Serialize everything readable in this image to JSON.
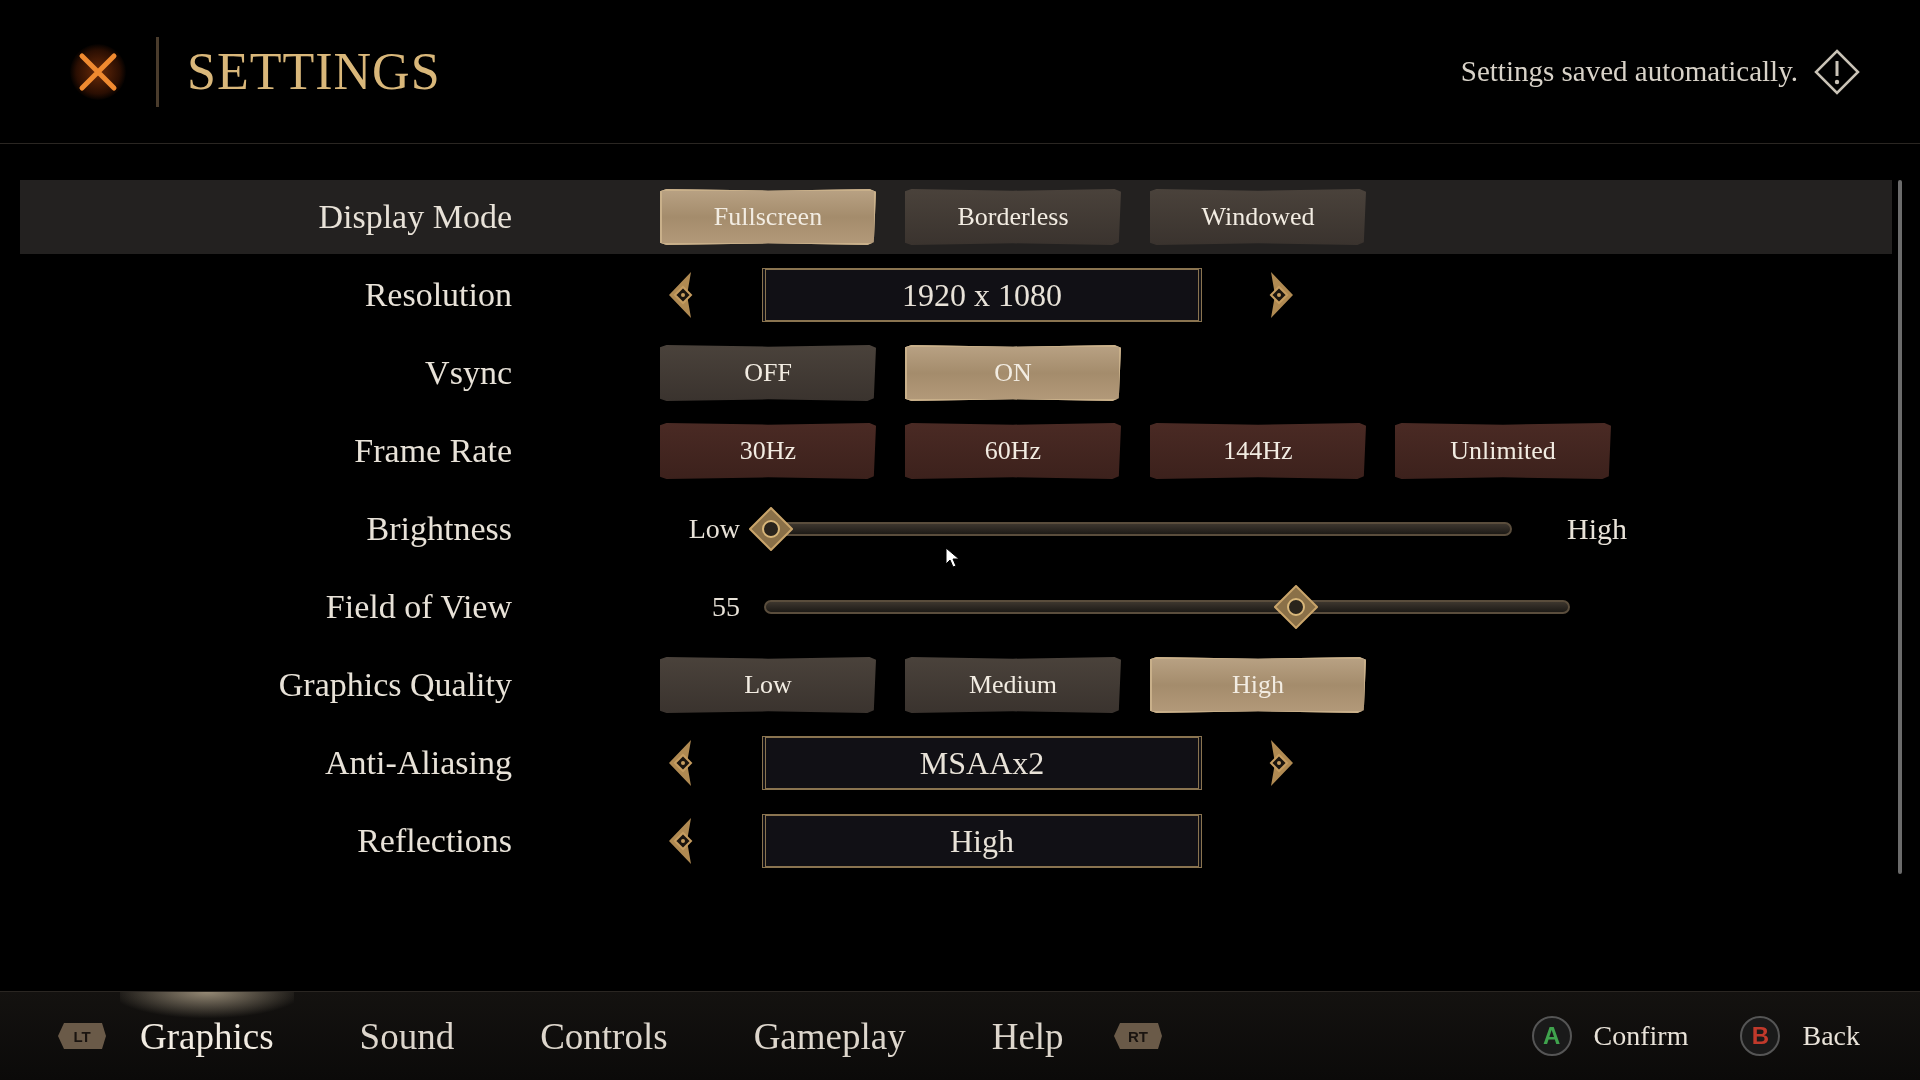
{
  "header": {
    "title": "SETTINGS",
    "status": "Settings saved automatically."
  },
  "rows": [
    {
      "label": "Display Mode",
      "kind": "options",
      "selected": true,
      "options": [
        {
          "label": "Fullscreen",
          "selected": true
        },
        {
          "label": "Borderless",
          "selected": false
        },
        {
          "label": "Windowed",
          "selected": false
        }
      ]
    },
    {
      "label": "Resolution",
      "kind": "stepper",
      "selected": false,
      "value": "1920 x 1080",
      "right_arrow": true
    },
    {
      "label": "Vsync",
      "kind": "options",
      "selected": false,
      "options": [
        {
          "label": "OFF",
          "selected": false
        },
        {
          "label": "ON",
          "selected": true
        }
      ]
    },
    {
      "label": "Frame Rate",
      "kind": "rate_options",
      "selected": false,
      "options": [
        {
          "label": "30Hz",
          "selected": false
        },
        {
          "label": "60Hz",
          "selected": false
        },
        {
          "label": "144Hz",
          "selected": false
        },
        {
          "label": "Unlimited",
          "selected": false
        }
      ]
    },
    {
      "label": "Brightness",
      "kind": "slider",
      "selected": false,
      "min_label": "Low",
      "max_label": "High",
      "level": 0.01
    },
    {
      "label": "Field of View",
      "kind": "slider",
      "selected": false,
      "min_label": "55",
      "level": 0.66
    },
    {
      "label": "Graphics Quality",
      "kind": "options",
      "selected": false,
      "options": [
        {
          "label": "Low",
          "selected": false
        },
        {
          "label": "Medium",
          "selected": false
        },
        {
          "label": "High",
          "selected": true
        }
      ]
    },
    {
      "label": "Anti-Aliasing",
      "kind": "stepper",
      "selected": false,
      "value": "MSAAx2",
      "right_arrow": true
    },
    {
      "label": "Reflections",
      "kind": "stepper",
      "selected": false,
      "value": "High",
      "right_arrow": false
    }
  ],
  "footer": {
    "prev_key": "LT",
    "next_key": "RT",
    "tabs": [
      {
        "label": "Graphics",
        "selected": true
      },
      {
        "label": "Sound",
        "selected": false
      },
      {
        "label": "Controls",
        "selected": false
      },
      {
        "label": "Gameplay",
        "selected": false
      },
      {
        "label": "Help",
        "selected": false
      }
    ],
    "actions": [
      {
        "key": "A",
        "label": "Confirm",
        "color": "#3fa34d"
      },
      {
        "key": "B",
        "label": "Back",
        "color": "#c0392b"
      }
    ]
  }
}
